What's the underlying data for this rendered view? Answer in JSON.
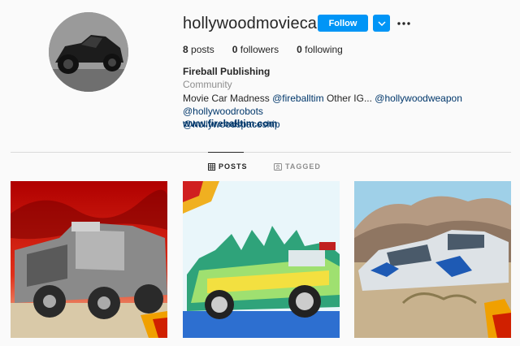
{
  "profile": {
    "username": "hollywoodmoviecar",
    "follow_label": "Follow",
    "avatar_icon": "batmobile-avatar",
    "stats": [
      {
        "count": "8",
        "label": "posts"
      },
      {
        "count": "0",
        "label": "followers"
      },
      {
        "count": "0",
        "label": "following"
      }
    ],
    "full_name": "Fireball Publishing",
    "category": "Community",
    "bio_text": "Movie Car Madness",
    "bio_tag_1": "@fireballtim",
    "bio_mid": "Other IG...",
    "bio_tag_2": "@hollywoodweapon",
    "bio_tag_3": "@hollywoodrobots",
    "bio_tag_4": "@hollywoodspaceship",
    "website": "www.fireballtim.com"
  },
  "tabs": {
    "posts": "POSTS",
    "tagged": "TAGGED"
  },
  "colors": {
    "accent": "#0095f6",
    "link": "#00376b",
    "muted": "#8e8e8e"
  },
  "posts": [
    {
      "name": "armored-vehicle-post"
    },
    {
      "name": "hot-wheels-car-post"
    },
    {
      "name": "futuristic-car-post"
    }
  ]
}
